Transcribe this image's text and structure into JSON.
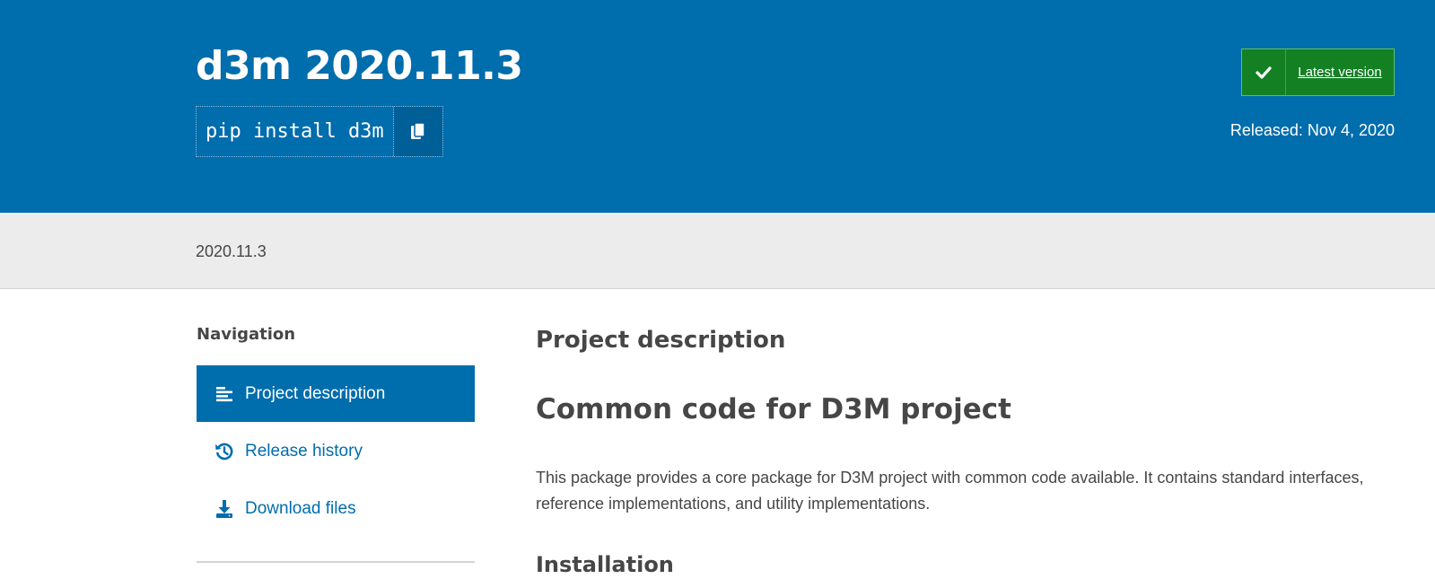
{
  "header": {
    "package_title": "d3m 2020.11.3",
    "pip_command": "pip install d3m",
    "copy_icon": "copy-icon",
    "latest_badge_label": "Latest version",
    "check_icon": "check-icon",
    "released": "Released: Nov 4, 2020"
  },
  "version_strip": {
    "version": "2020.11.3"
  },
  "sidebar": {
    "heading": "Navigation",
    "items": [
      {
        "label": "Project description",
        "icon": "align-left-icon",
        "active": true
      },
      {
        "label": "Release history",
        "icon": "history-icon",
        "active": false
      },
      {
        "label": "Download files",
        "icon": "download-icon",
        "active": false
      }
    ]
  },
  "main": {
    "section_heading": "Project description",
    "title": "Common code for D3M project",
    "paragraph": "This package provides a core package for D3M project with common code available. It contains standard interfaces, reference implementations, and utility implementations.",
    "subheading": "Installation"
  },
  "colors": {
    "brand_blue": "#006dad",
    "badge_green": "#148024",
    "strip_gray": "#ececec",
    "text_dark": "#464646"
  }
}
